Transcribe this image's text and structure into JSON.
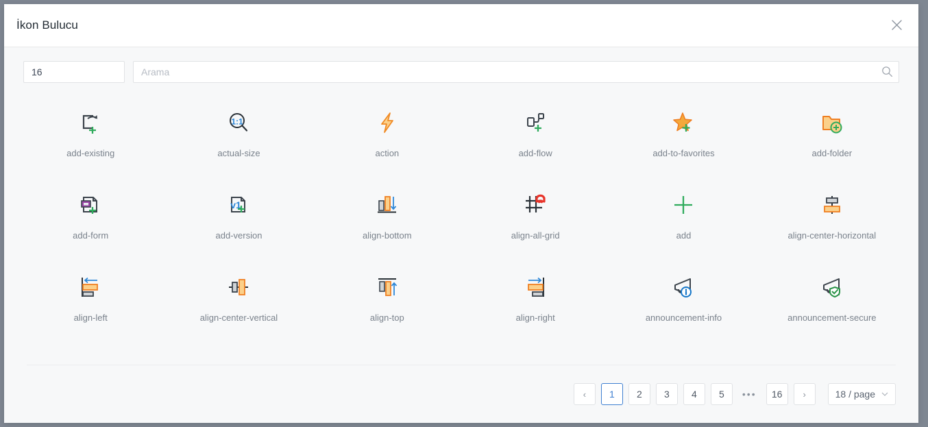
{
  "dialog": {
    "title": "İkon Bulucu",
    "close_icon": "close-icon"
  },
  "toolbar": {
    "size_value": "16",
    "size_placeholder": "16",
    "search_value": "",
    "search_placeholder": "Arama",
    "search_icon": "search-icon"
  },
  "icons": [
    {
      "name": "add-existing",
      "glyph": "add-existing"
    },
    {
      "name": "actual-size",
      "glyph": "actual-size"
    },
    {
      "name": "action",
      "glyph": "action"
    },
    {
      "name": "add-flow",
      "glyph": "add-flow"
    },
    {
      "name": "add-to-favorites",
      "glyph": "add-to-favorites"
    },
    {
      "name": "add-folder",
      "glyph": "add-folder"
    },
    {
      "name": "add-form",
      "glyph": "add-form"
    },
    {
      "name": "add-version",
      "glyph": "add-version"
    },
    {
      "name": "align-bottom",
      "glyph": "align-bottom"
    },
    {
      "name": "align-all-grid",
      "glyph": "align-all-grid"
    },
    {
      "name": "add",
      "glyph": "add"
    },
    {
      "name": "align-center-horizontal",
      "glyph": "align-center-horizontal"
    },
    {
      "name": "align-left",
      "glyph": "align-left"
    },
    {
      "name": "align-center-vertical",
      "glyph": "align-center-vertical"
    },
    {
      "name": "align-top",
      "glyph": "align-top"
    },
    {
      "name": "align-right",
      "glyph": "align-right"
    },
    {
      "name": "announcement-info",
      "glyph": "announcement-info"
    },
    {
      "name": "announcement-secure",
      "glyph": "announcement-secure"
    }
  ],
  "pagination": {
    "prev_label": "‹",
    "next_label": "›",
    "pages": [
      "1",
      "2",
      "3",
      "4",
      "5"
    ],
    "ellipsis": "•••",
    "last_page": "16",
    "active_page": "1",
    "page_size_label": "18 / page"
  },
  "colors": {
    "accent": "#3d7fd1",
    "green": "#2fab5c",
    "orange": "#f08a24",
    "orange_light": "#fbd08a",
    "dark": "#333b42",
    "gray": "#7a828c",
    "red": "#e8342a",
    "purple": "#9c46a8",
    "blue": "#2d87d8"
  }
}
